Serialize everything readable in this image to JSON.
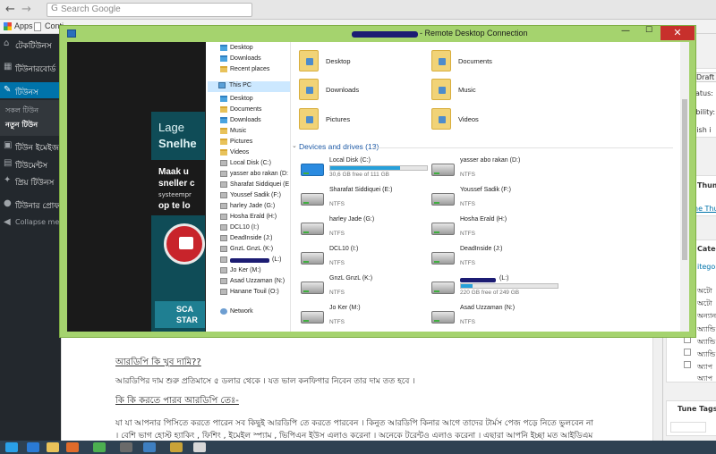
{
  "browser": {
    "search_placeholder": "Search Google",
    "bookmarks": {
      "apps": "Apps",
      "item2": "Conti"
    }
  },
  "wp_sidebar": {
    "items": [
      {
        "label": "টেকটিউনস"
      },
      {
        "label": "টিউনারবোর্ড"
      },
      {
        "label": "টিউনস"
      },
      {
        "label": "টিউন ইমেইজ"
      },
      {
        "label": "টিউমেন্টস"
      },
      {
        "label": "প্রিয় টিউনস"
      },
      {
        "label": "টিউনার প্রোফ"
      },
      {
        "label": "Collapse menu"
      }
    ],
    "sub_items": [
      {
        "label": "সকল টিউন"
      },
      {
        "label": "নতুন টিউন"
      }
    ]
  },
  "editor": {
    "heading1": "আরডিপি কি খুব দামি??",
    "para1": "আরডিপির দাম শুরু প্রতিমাসে ৫ ডলার থেকে । যত ভাল কনফিগার নিবেন তার দাম তত হবে ।",
    "heading2": "কি কি করতে পারব আরডিপি তেঃ-",
    "para2": "যা যা আপনার পিসিতে করতে পারেন সব কিছুই আরডিপি তে করতে পারবেন । কিনুত আরডিপি কিনার আগে তাদের টার্মস পেজ পড়ে নিতে ভুলবেন না",
    "para3": "। বেশি ভাগ হোস্ট হ্যাকিং , ফিশিং , ইমেইল স্প্যাম , ভিপিএন ইউস এলাও করেনা । অনেকে টরেন্টও এলাও করেনা । এছারা আপনি ইচ্ছা মত আইডিএম"
  },
  "meta": {
    "draft_btn": "Draft",
    "status": "atus: D",
    "visibility": "sibility:",
    "publish": "blish i",
    "thumb_title": "Thumb",
    "thumb_link": "ne Thu",
    "categories_title": "Categ",
    "categories_tab": "itegorie",
    "cat_items": [
      "অটো",
      "অটো",
      "অন্যান",
      "অ্যান্ডি",
      "অ্যান্ডি",
      "অ্যান্ডি",
      "অ্যাপ",
      "অ্যাপ"
    ],
    "tags_title": "Tune Tags"
  },
  "rdp": {
    "title": " - Remote Desktop Connection",
    "ad": {
      "line1": "Lage",
      "line2": "Snelhe",
      "small1": "Maak u",
      "small2": "sneller c",
      "tiny": "systeempr",
      "small3": "op te lo",
      "cta1": "SCA",
      "cta2": "STAR"
    },
    "nav": [
      {
        "label": "Desktop",
        "icon": "folder-blue"
      },
      {
        "label": "Downloads",
        "icon": "folder-blue"
      },
      {
        "label": "Recent places",
        "icon": "folder"
      },
      {
        "label": "This PC",
        "icon": "pc"
      },
      {
        "label": "Desktop",
        "icon": "folder-blue"
      },
      {
        "label": "Documents",
        "icon": "folder"
      },
      {
        "label": "Downloads",
        "icon": "folder-blue"
      },
      {
        "label": "Music",
        "icon": "folder"
      },
      {
        "label": "Pictures",
        "icon": "folder"
      },
      {
        "label": "Videos",
        "icon": "folder"
      },
      {
        "label": "Local Disk (C:)",
        "icon": "disk"
      },
      {
        "label": "yasser abo rakan (D:",
        "icon": "disk"
      },
      {
        "label": "Sharafat Siddiquei (E",
        "icon": "disk"
      },
      {
        "label": "Youssef Sadik (F:)",
        "icon": "disk"
      },
      {
        "label": "harley Jade (G:)",
        "icon": "disk"
      },
      {
        "label": "Hosha Erald (H:)",
        "icon": "disk"
      },
      {
        "label": "DCL10 (I:)",
        "icon": "disk"
      },
      {
        "label": "DeadInside (J:)",
        "icon": "disk"
      },
      {
        "label": "GnzL GnzL (K:)",
        "icon": "disk"
      },
      {
        "label": "(L:)",
        "icon": "disk"
      },
      {
        "label": "Jo Ker (M:)",
        "icon": "disk"
      },
      {
        "label": "Asad Uzzaman (N:)",
        "icon": "disk"
      },
      {
        "label": "Hanane Touil (O:)",
        "icon": "disk"
      },
      {
        "label": "Network",
        "icon": "net"
      }
    ],
    "folders": [
      "Desktop",
      "Documents",
      "Downloads",
      "Music",
      "Pictures",
      "Videos"
    ],
    "devices_header": "Devices and drives (13)",
    "drives": [
      {
        "name": "Local Disk (C:)",
        "sub": "30,6 GB free of 111 GB",
        "bar": 0.72,
        "win": true
      },
      {
        "name": "yasser abo rakan (D:)",
        "sub": "NTFS"
      },
      {
        "name": "Sharafat Siddiquei (E:)",
        "sub": "NTFS"
      },
      {
        "name": "Youssef Sadik (F:)",
        "sub": "NTFS"
      },
      {
        "name": "harley Jade (G:)",
        "sub": "NTFS"
      },
      {
        "name": "Hosha Erald (H:)",
        "sub": "NTFS"
      },
      {
        "name": "DCL10 (I:)",
        "sub": "NTFS"
      },
      {
        "name": "DeadInside (J:)",
        "sub": "NTFS"
      },
      {
        "name": "GnzL GnzL (K:)",
        "sub": "NTFS"
      },
      {
        "name": "(L:)",
        "sub": "220 GB free of 249 GB",
        "bar": 0.12,
        "redacted": true
      },
      {
        "name": "Jo Ker (M:)",
        "sub": "NTFS"
      },
      {
        "name": "Asad Uzzaman (N:)",
        "sub": "NTFS"
      }
    ]
  }
}
